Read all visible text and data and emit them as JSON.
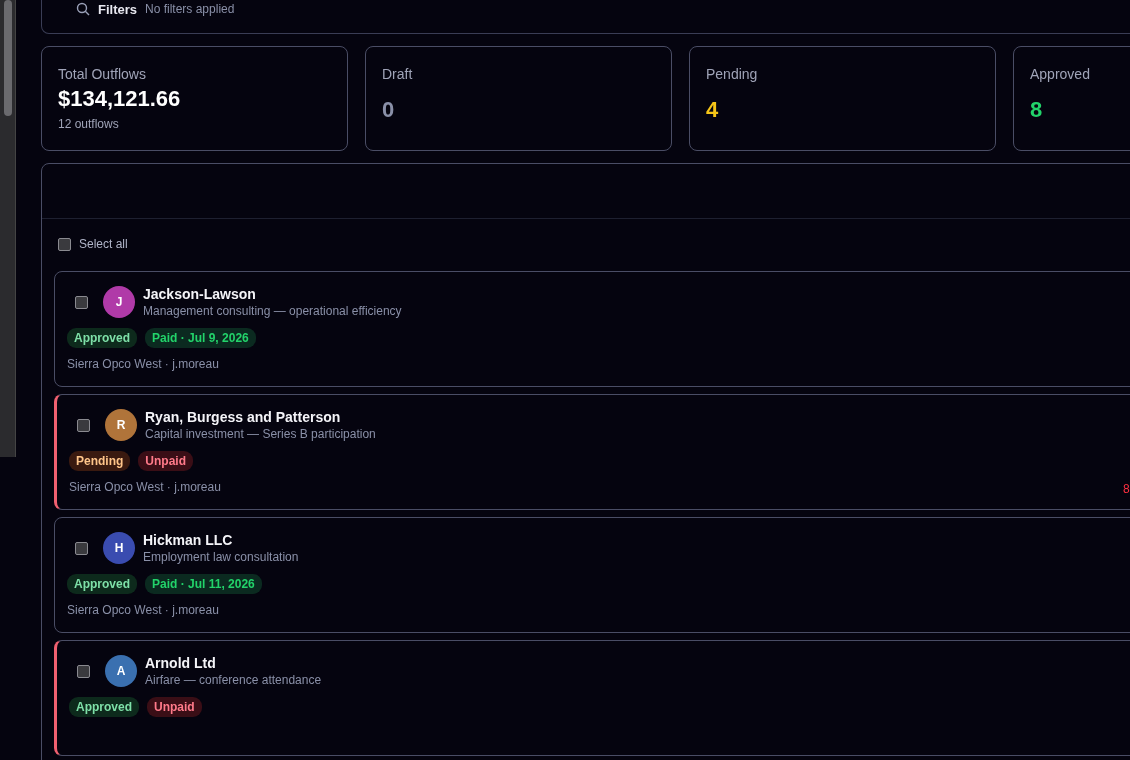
{
  "filters": {
    "label": "Filters",
    "value": "No filters applied"
  },
  "stats": [
    {
      "label": "Total Outflows",
      "value": "$134,121.66",
      "sub": "12 outflows",
      "kind": "total"
    },
    {
      "label": "Draft",
      "value": "0",
      "kind": "draft"
    },
    {
      "label": "Pending",
      "value": "4",
      "kind": "pending"
    },
    {
      "label": "Approved",
      "value": "8",
      "kind": "approved"
    }
  ],
  "select_all": {
    "label": "Select all",
    "checked": false
  },
  "outflows": [
    {
      "initial": "J",
      "color": "#b03aa8",
      "name": "Jackson-Lawson",
      "description": "Management consulting — operational efficiency",
      "checked": false,
      "status": {
        "kind": "approved",
        "label": "Approved"
      },
      "payment": {
        "kind": "paid",
        "label": "Paid · Jul 9, 2026"
      },
      "meta": "Sierra Opco West · j.moreau"
    },
    {
      "initial": "R",
      "color": "#b0743a",
      "name": "Ryan, Burgess and Patterson",
      "description": "Capital investment — Series B participation",
      "checked": false,
      "status": {
        "kind": "pending",
        "label": "Pending"
      },
      "payment": {
        "kind": "unpaid",
        "label": "Unpaid"
      },
      "meta": "Sierra Opco West · j.moreau",
      "amount": "8"
    },
    {
      "initial": "H",
      "color": "#3a4cb0",
      "name": "Hickman LLC",
      "description": "Employment law consultation",
      "checked": false,
      "status": {
        "kind": "approved",
        "label": "Approved"
      },
      "payment": {
        "kind": "paid",
        "label": "Paid · Jul 11, 2026"
      },
      "meta": "Sierra Opco West · j.moreau"
    },
    {
      "initial": "A",
      "color": "#3a70b0",
      "name": "Arnold Ltd",
      "description": "Airfare — conference attendance",
      "checked": false,
      "status": {
        "kind": "approved",
        "label": "Approved"
      },
      "payment": {
        "kind": "unpaid",
        "label": "Unpaid"
      }
    }
  ]
}
